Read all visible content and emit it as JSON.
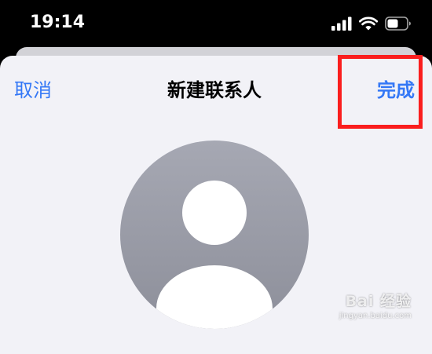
{
  "status_bar": {
    "time": "19:14",
    "icons": [
      "cellular-signal-icon",
      "wifi-icon",
      "battery-icon"
    ]
  },
  "navigation": {
    "cancel_label": "取消",
    "title": "新建联系人",
    "done_label": "完成"
  },
  "avatar": {
    "icon": "person-placeholder-icon"
  },
  "watermark": {
    "main": "Bai 经验",
    "sub": "jingyan.baidu.com"
  },
  "colors": {
    "accent": "#3478f6",
    "sheet_background": "#f2f2f7",
    "highlight": "#fa1e1e",
    "avatar": "#9a9ca7"
  }
}
